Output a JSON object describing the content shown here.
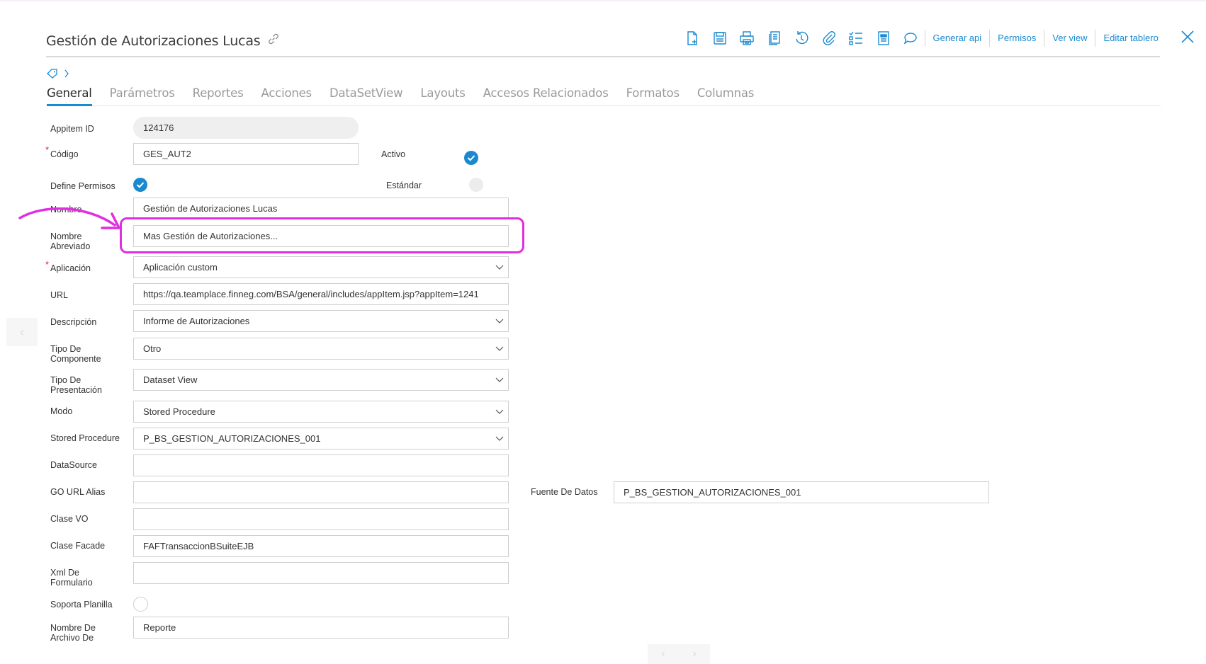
{
  "header": {
    "title": "Gestión de Autorizaciones Lucas",
    "toolbar_icons": [
      "new-document-icon",
      "save-icon",
      "print-icon",
      "copy-document-icon",
      "history-icon",
      "attachment-icon",
      "checklist-icon",
      "report-icon",
      "comment-icon"
    ],
    "links": [
      "Generar api",
      "Permisos",
      "Ver view",
      "Editar tablero"
    ]
  },
  "tabs": [
    "General",
    "Parámetros",
    "Reportes",
    "Acciones",
    "DataSetView",
    "Layouts",
    "Accesos Relacionados",
    "Formatos",
    "Columnas"
  ],
  "form": {
    "appitem_id": {
      "label": "Appitem ID",
      "value": "124176"
    },
    "codigo": {
      "label": "Código",
      "value": "GES_AUT2"
    },
    "activo": {
      "label": "Activo"
    },
    "define_permisos": {
      "label": "Define Permisos"
    },
    "estandar": {
      "label": "Estándar"
    },
    "nombre": {
      "label": "Nombre",
      "value": "Gestión de Autorizaciones Lucas"
    },
    "nombre_abreviado": {
      "label_line1": "Nombre",
      "label_line2": "Abreviado",
      "value": "Mas Gestión de Autorizaciones..."
    },
    "aplicacion": {
      "label": "Aplicación",
      "value": "Aplicación custom"
    },
    "url": {
      "label": "URL",
      "value": "https://qa.teamplace.finneg.com/BSA/general/includes/appItem.jsp?appItem=1241"
    },
    "descripcion": {
      "label": "Descripción",
      "value": "Informe de Autorizaciones"
    },
    "tipo_componente": {
      "label_line1": "Tipo De",
      "label_line2": "Componente",
      "value": "Otro"
    },
    "tipo_presentacion": {
      "label_line1": "Tipo De",
      "label_line2": "Presentación",
      "value": "Dataset View"
    },
    "modo": {
      "label": "Modo",
      "value": "Stored Procedure"
    },
    "stored_procedure": {
      "label": "Stored Procedure",
      "value": "P_BS_GESTION_AUTORIZACIONES_001"
    },
    "datasource": {
      "label": "DataSource",
      "value": ""
    },
    "go_url_alias": {
      "label": "GO URL Alias",
      "value": ""
    },
    "fuente_datos": {
      "label": "Fuente De Datos",
      "value": "P_BS_GESTION_AUTORIZACIONES_001"
    },
    "clase_vo": {
      "label": "Clase VO",
      "value": ""
    },
    "clase_facade": {
      "label": "Clase Facade",
      "value": "FAFTransaccionBSuiteEJB"
    },
    "xml_formulario": {
      "label_line1": "Xml De",
      "label_line2": "Formulario",
      "value": ""
    },
    "soporta_planilla": {
      "label": "Soporta Planilla"
    },
    "nombre_archivo": {
      "label_line1": "Nombre De",
      "label_line2": "Archivo De",
      "value": "Reporte"
    }
  },
  "colors": {
    "accent": "#1a8ad0",
    "highlight": "#e02fe0",
    "required": "#e0252a"
  }
}
